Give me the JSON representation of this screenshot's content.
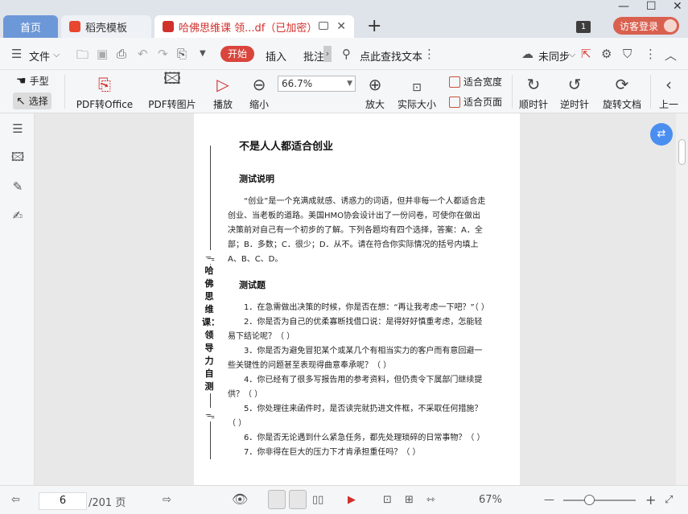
{
  "tabs": {
    "home": "首页",
    "template": "稻壳模板",
    "document": "哈佛思维课 领...df（已加密）",
    "new_tab": "+",
    "page_count_badge": "1",
    "visitor_login": "访客登录"
  },
  "menu": {
    "file": "文件",
    "start": "开始",
    "insert": "插入",
    "annotate": "批注",
    "search_text": "点此查找文本",
    "sync": "未同步"
  },
  "ribbon": {
    "hand": "手型",
    "select": "选择",
    "pdf_to_office": "PDF转Office",
    "pdf_to_image": "PDF转图片",
    "play": "播放",
    "zoom_out": "缩小",
    "zoom_value": "66.7%",
    "zoom_in": "放大",
    "actual_size": "实际大小",
    "fit_width": "适合宽度",
    "fit_page": "适合页面",
    "rotate_cw": "顺时针",
    "rotate_ccw": "逆时针",
    "rotate_doc": "旋转文档",
    "prev": "上一"
  },
  "document": {
    "title": "不是人人都适合创业",
    "section1": "测试说明",
    "intro": "“创业”是一个充满成就感、诱惑力的词语，但并非每一个人都适合走创业、当老板的道路。美国HMO协会设计出了一份问卷，可使你在做出决策前对自己有一个初步的了解。下列各题均有四个选择，答案：A．全部；B．多数；C．很少；D．从不。请在符合你实际情况的括号内填上A、B、C、D。",
    "section2": "测试题",
    "questions": [
      "1．在急需做出决策的时候，你是否在想：“再让我考虑一下吧？”（ ）",
      "2．你是否为自己的优柔寡断找借口说：是得好好慎重考虑，怎能轻易下结论呢？（ ）",
      "3．你是否为避免冒犯某个或某几个有相当实力的客户而有意回避一些关键性的问题甚至表现得曲意奉承呢？（ ）",
      "4．你已经有了很多写报告用的参考资料，但仍责令下属部门继续提供？（ ）",
      "5．你处理往来函件时，是否读完就扔进文件框，不采取任何措施？（ ）",
      "6．你是否无论遇到什么紧急任务，都先处理琐碎的日常事物？（ ）",
      "7．你非得在巨大的压力下才肯承担重任吗？（ ）"
    ],
    "vertical_title": "哈佛思维课：领导力自测"
  },
  "status": {
    "current_page": "6",
    "total_pages": "/201 页",
    "zoom": "67%"
  }
}
